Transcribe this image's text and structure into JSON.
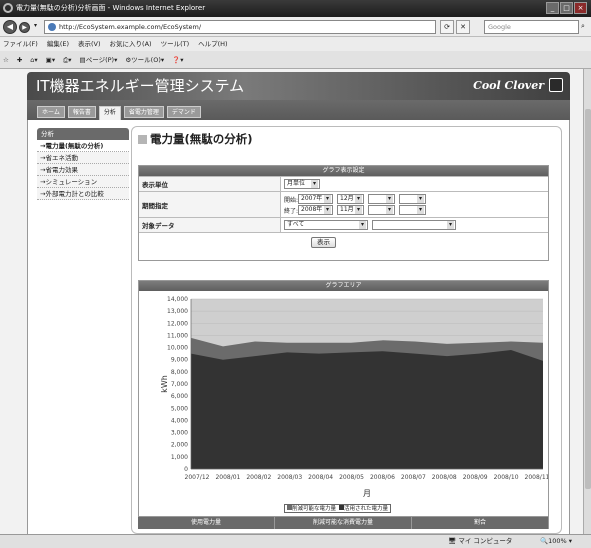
{
  "window": {
    "title": "電力量(無駄の分析)分析画面 - Windows Internet Explorer"
  },
  "browser": {
    "url": "http://EcoSystem.example.com/EcoSystem/",
    "search_placeholder": "Google",
    "menu": [
      "ファイル(F)",
      "編集(E)",
      "表示(V)",
      "お気に入り(A)",
      "ツール(T)",
      "ヘルプ(H)"
    ],
    "commands": [
      "ページ(P)",
      "ツール(O)"
    ]
  },
  "app": {
    "title": "IT機器エネルギー管理システム",
    "brand": "Cool Clover"
  },
  "tabs": [
    "ホーム",
    "報告書",
    "分析",
    "省電力管理",
    "デマンド"
  ],
  "active_tab": 2,
  "sidebar": {
    "heading": "分析",
    "items": [
      "→電力量(無駄の分析)",
      "→省エネ活動",
      "→省電力効果",
      "→シミュレーション",
      "→外部電力計との比較"
    ]
  },
  "page_title": "電力量(無駄の分析)",
  "settings": {
    "header": "グラフ表示設定",
    "unit_label": "表示単位",
    "unit_value": "月単位",
    "period_label": "期間指定",
    "start_label": "開始:",
    "start_year": "2007年",
    "start_month": "12月",
    "end_label": "終了:",
    "end_year": "2008年",
    "end_month": "11月",
    "target_label": "対象データ",
    "target_value": "すべて",
    "show_button": "表示"
  },
  "graph": {
    "header": "グラフエリア"
  },
  "chart_data": {
    "type": "area",
    "stacked": true,
    "x": [
      "2007/12",
      "2008/01",
      "2008/02",
      "2008/03",
      "2008/04",
      "2008/05",
      "2008/06",
      "2008/07",
      "2008/08",
      "2008/09",
      "2008/10",
      "2008/11"
    ],
    "xlabel": "月",
    "ylabel": "kWh",
    "ylim": [
      0,
      14000
    ],
    "yticks": [
      "0",
      "1,000",
      "2,000",
      "3,000",
      "4,000",
      "5,000",
      "6,000",
      "7,000",
      "8,000",
      "9,000",
      "10,000",
      "11,000",
      "12,000",
      "13,000",
      "14,000"
    ],
    "series": [
      {
        "name": "活用された電力量",
        "values": [
          9500,
          9000,
          9300,
          9600,
          9500,
          9600,
          9700,
          9500,
          9300,
          9500,
          9800,
          8900
        ],
        "color": "#333333"
      },
      {
        "name": "削減可能な電力量",
        "values": [
          1300,
          1100,
          1200,
          800,
          900,
          800,
          900,
          1000,
          1000,
          900,
          700,
          1500
        ],
        "color": "#6b6b6b"
      }
    ],
    "legend_order": [
      "削減可能な電力量",
      "活用された電力量"
    ],
    "legend_position": "bottom",
    "grid": true
  },
  "summary": {
    "headers": [
      "使用電力量",
      "削減可能な消費電力量",
      "割合"
    ]
  },
  "status": {
    "zone": "マイ コンピュータ",
    "zoom": "100%"
  }
}
